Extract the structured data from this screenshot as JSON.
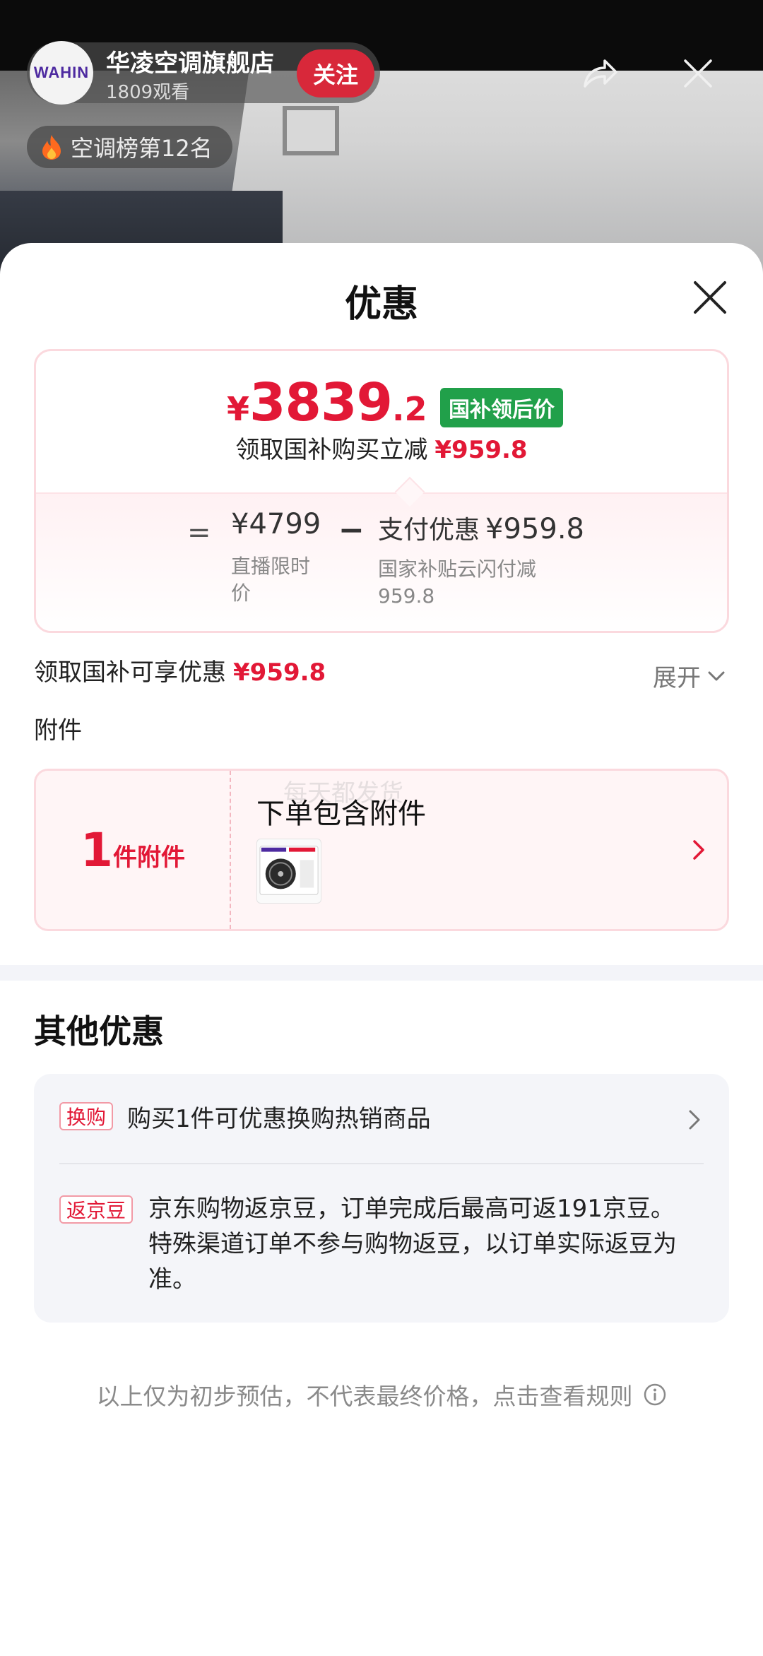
{
  "live": {
    "store_logo_text": "WAHIN",
    "store_name": "华凌空调旗舰店",
    "viewers": "1809观看",
    "follow_label": "关注",
    "rank_label": "空调榜第12名",
    "icons": [
      "share-icon",
      "close-icon",
      "flame-icon"
    ]
  },
  "sheet": {
    "title": "优惠",
    "price": {
      "currency": "¥",
      "integer": "3839",
      "decimal": ".2",
      "tag": "国补领后价",
      "subsidy_text": "领取国补购买立减",
      "subsidy_amount": "¥959.8",
      "equals": "=",
      "original_price": "¥4799",
      "original_label": "直播限时价",
      "minus": "−",
      "discount_title": "支付优惠",
      "discount_amount": "¥959.8",
      "discount_desc": "国家补贴云闪付减959.8"
    },
    "enjoy": {
      "text": "领取国补可享优惠",
      "amount": "¥959.8",
      "expand_label": "展开"
    },
    "attachments": {
      "heading": "附件",
      "count": "1",
      "count_unit": "件附件",
      "title": "下单包含附件",
      "watermark": "每天都发货"
    },
    "other": {
      "title": "其他优惠",
      "rows": [
        {
          "tag": "换购",
          "text": "购买1件可优惠换购热销商品"
        },
        {
          "tag": "返京豆",
          "text": "京东购物返京豆，订单完成后最高可返191京豆。特殊渠道订单不参与购物返豆，以订单实际返豆为准。"
        }
      ]
    },
    "footer_note": "以上仅为初步预估，不代表最终价格，点击查看规则"
  },
  "colors": {
    "accent_red": "#e21836",
    "tag_green": "#21a04a",
    "follow_red": "#d8283a"
  }
}
